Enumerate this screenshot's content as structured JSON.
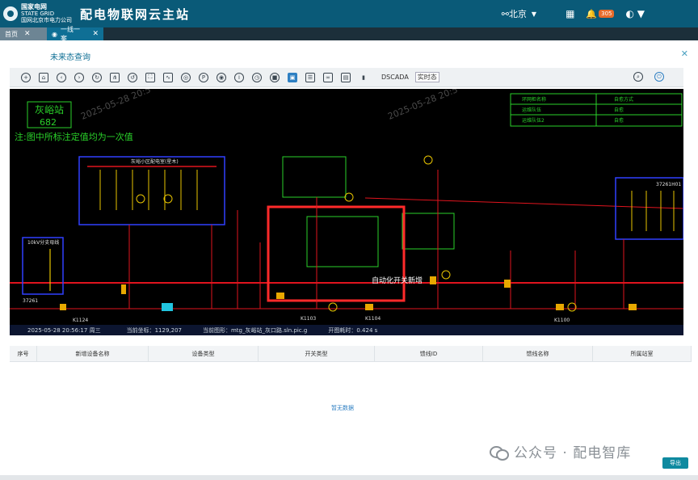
{
  "header": {
    "logo_line1": "国家电网",
    "logo_line2": "STATE GRID",
    "logo_line3": "国网北京市电力公司",
    "app_title": "配电物联网云主站",
    "city": "北京",
    "notification_count": "305"
  },
  "tabs": [
    {
      "label": "首页"
    },
    {
      "label": "一线一案"
    }
  ],
  "panel": {
    "title": "未来态查询"
  },
  "toolbar": {
    "dscada_label": "DSCADA",
    "mode_select": "实时态"
  },
  "diagram": {
    "station_name": "灰峪站",
    "station_id": "682",
    "note": "注:图中所标注定值均为一次值",
    "timestamp_watermark": "2025-05-28 20:5",
    "box1_title": "灰峪小区配电室(星木)",
    "box2_title": "10kV分支母线",
    "box_right_id": "37261H01",
    "annotation": "自动化开关新增",
    "legend_rows": [
      [
        "环网柜名称",
        "自愈方式"
      ],
      [
        "运维队伍",
        "自愈"
      ],
      [
        "运维队伍2",
        "自愈"
      ]
    ],
    "bottom_labels": [
      "37261",
      "K1124",
      "K1100",
      "K1104",
      "K1103"
    ]
  },
  "status_bar": {
    "datetime": "2025-05-28 20:56:17 周三",
    "coords": "当前坐标：1129,207",
    "graphic": "当前图形：mtg_灰峪站_灰口路.sln.pic.g",
    "load_time": "开图耗时：0.424 s"
  },
  "table": {
    "columns": [
      "序号",
      "新增设备名称",
      "设备类型",
      "开关类型",
      "馈线ID",
      "馈线名称",
      "所属站室"
    ],
    "empty_text": "暂无数据"
  },
  "export_label": "导出",
  "watermark_text": "公众号 · 配电智库",
  "colors": {
    "header": "#0a5a78",
    "tab_active": "#0f6f95",
    "accent": "#2e7fc2"
  }
}
